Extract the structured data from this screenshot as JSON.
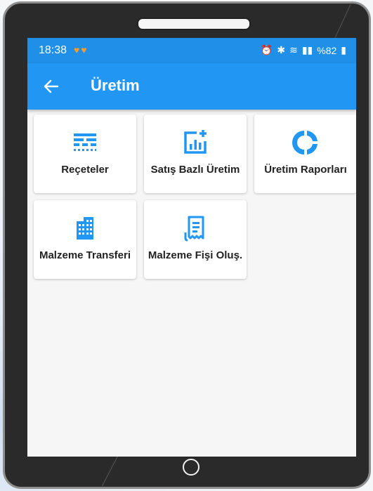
{
  "status_bar": {
    "time": "18:38",
    "hearts": "♥♥",
    "battery_text": "%82"
  },
  "app_bar": {
    "title": "Üretim"
  },
  "tiles": [
    {
      "label": "Reçeteler",
      "icon": "recipe-list-icon"
    },
    {
      "label": "Satış Bazlı Üretim",
      "icon": "chart-add-icon"
    },
    {
      "label": "Üretim Raporları",
      "icon": "donut-chart-icon"
    },
    {
      "label": "Malzeme Transferi",
      "icon": "building-icon"
    },
    {
      "label": "Malzeme Fişi Oluş.",
      "icon": "receipt-icon"
    }
  ],
  "colors": {
    "accent": "#2196f3",
    "status_bar": "#1f8fe8"
  }
}
